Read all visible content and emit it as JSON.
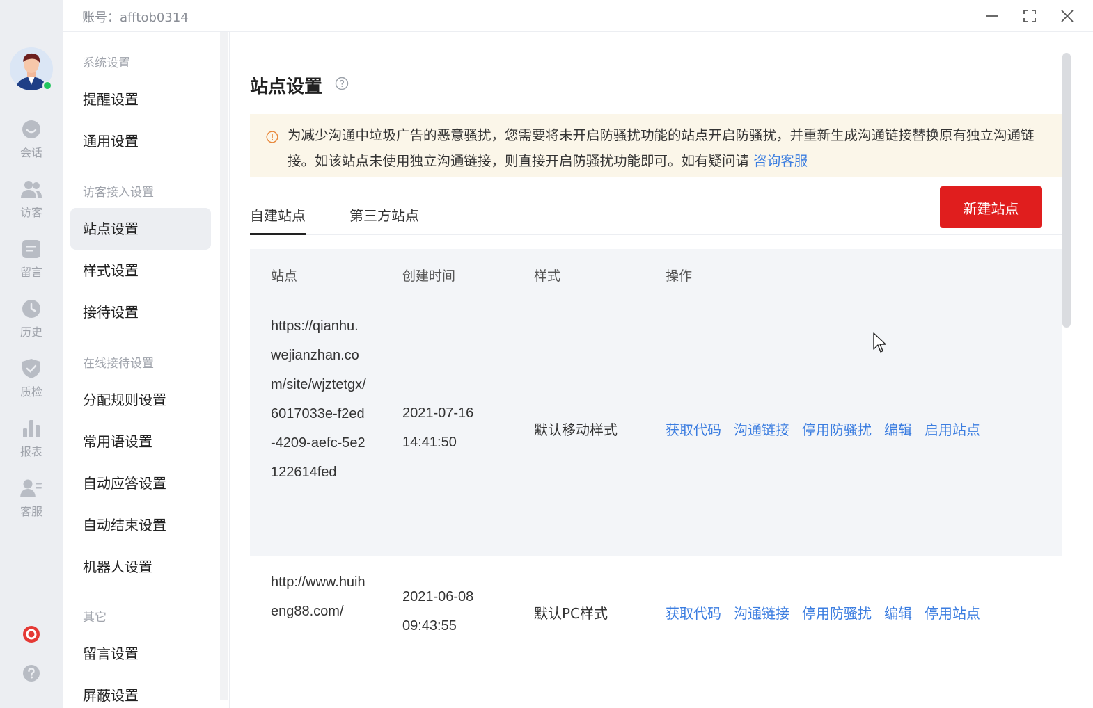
{
  "titlebar": {
    "account": "账号：afftob0314"
  },
  "rail": {
    "items": [
      {
        "label": "会话",
        "icon": "chat-icon"
      },
      {
        "label": "访客",
        "icon": "visitors-icon"
      },
      {
        "label": "留言",
        "icon": "message-icon"
      },
      {
        "label": "历史",
        "icon": "history-icon"
      },
      {
        "label": "质检",
        "icon": "quality-check-icon"
      },
      {
        "label": "报表",
        "icon": "report-icon"
      },
      {
        "label": "客服",
        "icon": "agent-icon"
      }
    ]
  },
  "menu": {
    "groups": {
      "system": "系统设置",
      "visitor_access": "访客接入设置",
      "online_reception": "在线接待设置",
      "other": "其它"
    },
    "items": {
      "reminder": "提醒设置",
      "general": "通用设置",
      "site": "站点设置",
      "style": "样式设置",
      "reception": "接待设置",
      "distribution": "分配规则设置",
      "phrases": "常用语设置",
      "auto_reply": "自动应答设置",
      "auto_end": "自动结束设置",
      "robot": "机器人设置",
      "leave_message": "留言设置",
      "block": "屏蔽设置"
    }
  },
  "main": {
    "title": "站点设置",
    "notice": {
      "text": "为减少沟通中垃圾广告的恶意骚扰，您需要将未开启防骚扰功能的站点开启防骚扰，并重新生成沟通链接替换原有独立沟通链接。如该站点未使用独立沟通链接，则直接开启防骚扰功能即可。如有疑问请 ",
      "link": "咨询客服"
    },
    "tabs": [
      "自建站点",
      "第三方站点"
    ],
    "new_button": "新建站点",
    "table": {
      "headers": [
        "站点",
        "创建时间",
        "样式",
        "操作"
      ],
      "rows": [
        {
          "site": "https://qianhu.wejianzhan.com/site/wjztetgx/6017033e-f2ed-4209-aefc-5e2122614fed",
          "date": "2021-07-16",
          "time": "14:41:50",
          "style": "默认移动样式",
          "ops": [
            "获取代码",
            "沟通链接",
            "停用防骚扰",
            "编辑",
            "启用站点"
          ]
        },
        {
          "site": "http://www.huiheng88.com/",
          "date": "2021-06-08",
          "time": "09:43:55",
          "style": "默认PC样式",
          "ops": [
            "获取代码",
            "沟通链接",
            "停用防骚扰",
            "编辑",
            "停用站点"
          ]
        }
      ]
    }
  },
  "colors": {
    "accent": "#3b7de0",
    "primary_button": "#e01e1e",
    "online": "#22c55e"
  }
}
